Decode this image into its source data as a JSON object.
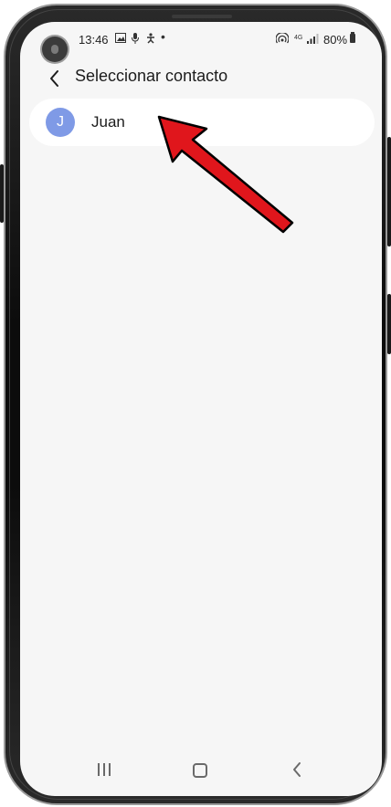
{
  "status_bar": {
    "time": "13:46",
    "battery": "80%",
    "network": "4G",
    "icons": [
      "gallery-icon",
      "microphone-icon",
      "accessibility-icon",
      "notification-dot-icon",
      "hotspot-icon",
      "signal-icon",
      "battery-icon"
    ]
  },
  "header": {
    "title": "Seleccionar contacto",
    "back_icon": "chevron-left-icon"
  },
  "contacts": [
    {
      "initial": "J",
      "name": "Juan",
      "avatar_color": "#7f9ae6"
    }
  ],
  "nav_bar": {
    "icons": [
      "recents-icon",
      "home-icon",
      "back-icon"
    ]
  },
  "annotation": {
    "arrow_color": "#e0161c",
    "points_to": "contact Juan"
  },
  "colors": {
    "screen_bg": "#f6f6f6",
    "row_bg": "#ffffff",
    "phone_body": "#0c0c0c"
  }
}
